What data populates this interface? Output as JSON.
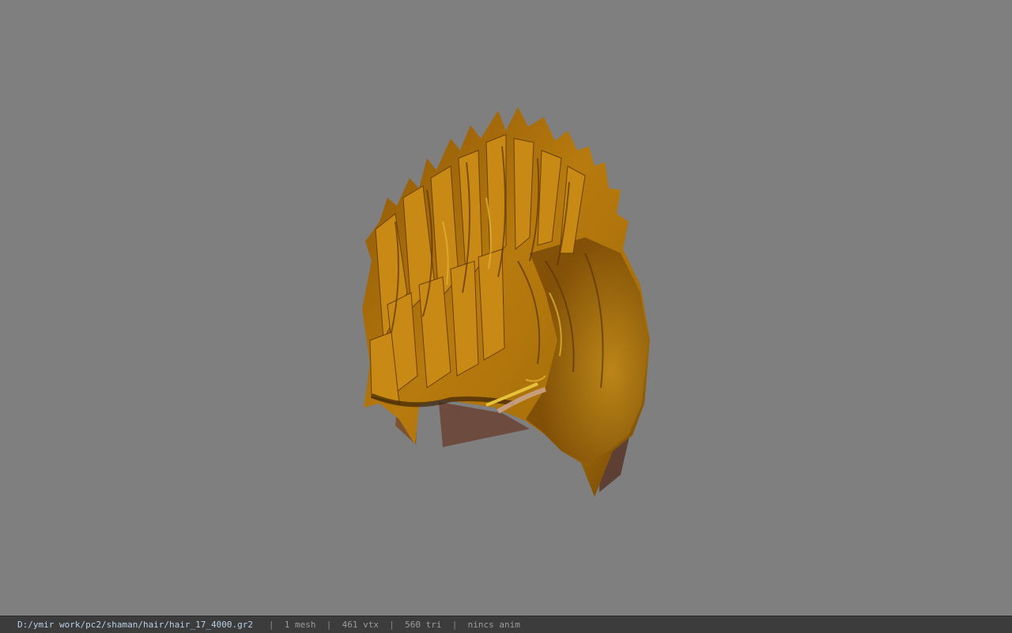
{
  "viewport": {
    "background": "#7f7f7f",
    "model": {
      "icon": "hair-mesh-render",
      "colors": {
        "base": "#a86c08",
        "highlight": "#d9a022",
        "shadow": "#5a3606",
        "underside": "#6e4b3f"
      }
    }
  },
  "statusbar": {
    "path": "D:/ymir work/pc2/shaman/hair/hair_17_4000.gr2",
    "separator": "|",
    "mesh_count": "1 mesh",
    "vertex_count": "461 vtx",
    "triangle_count": "560 tri",
    "anim": "nincs anim"
  }
}
